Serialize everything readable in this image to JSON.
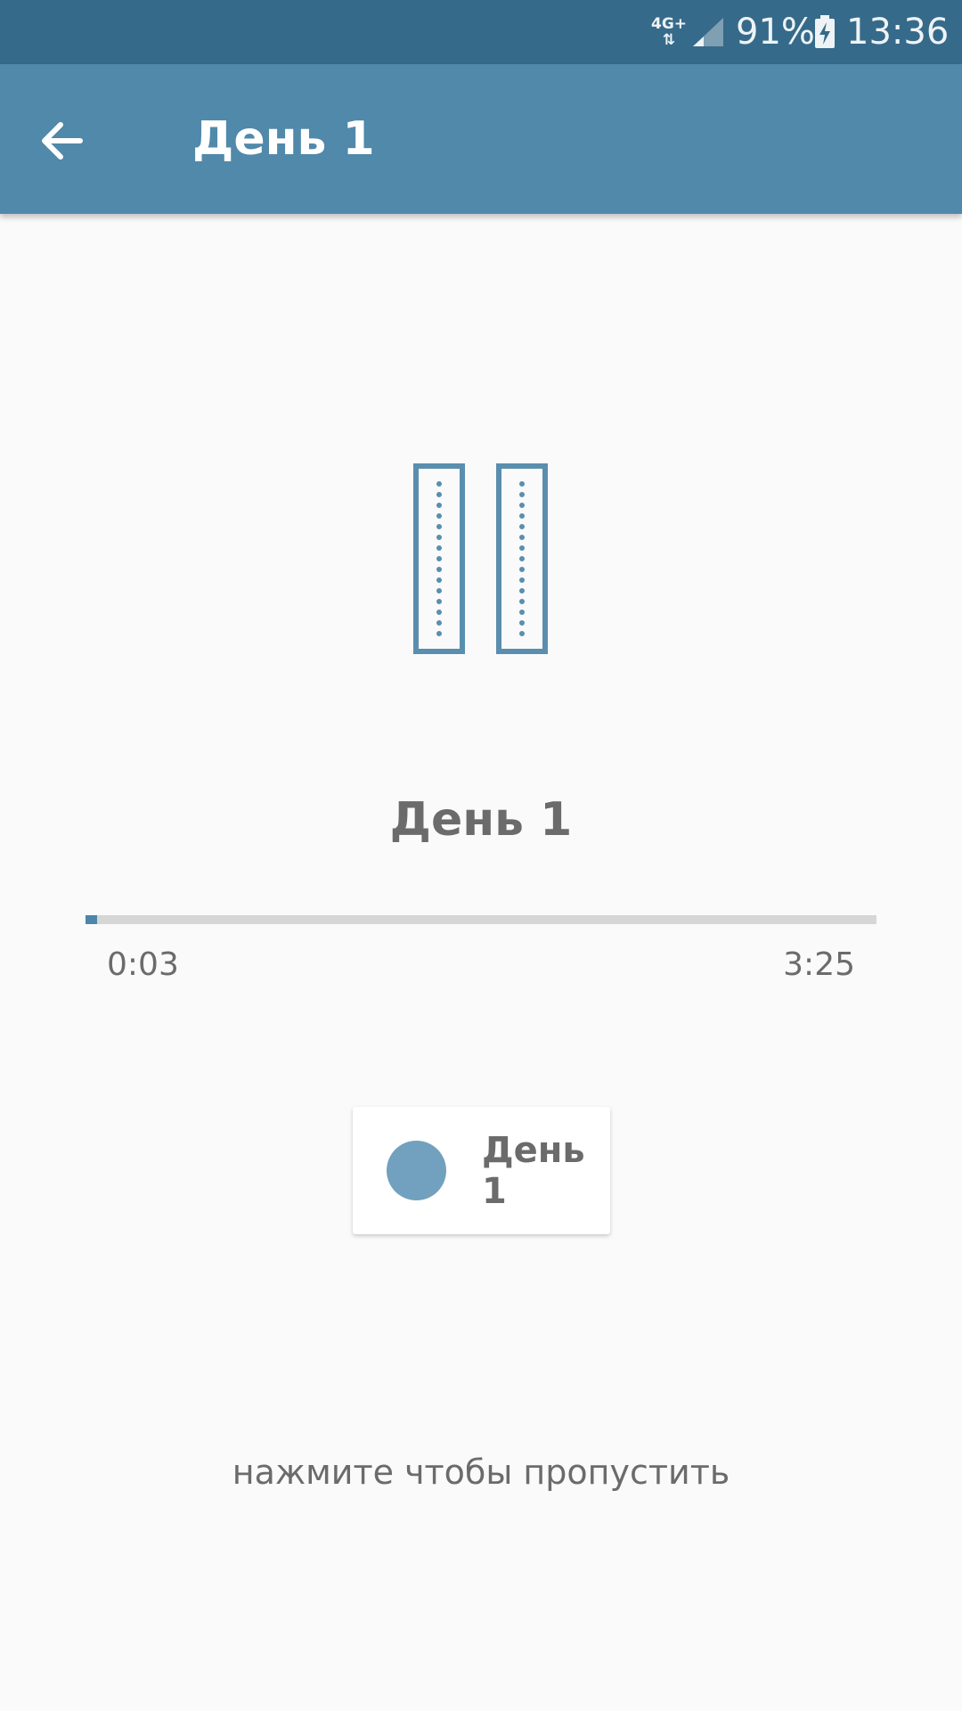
{
  "status_bar": {
    "network_top": "4G+",
    "network_bottom": "⇅",
    "battery_percent": "91%",
    "time": "13:36",
    "icons": [
      "signal-icon",
      "battery-charging-icon"
    ]
  },
  "app_bar": {
    "back_icon": "arrow-back-icon",
    "title": "День 1"
  },
  "player": {
    "pause_icon": "pause-icon",
    "track_title": "День 1",
    "progress_fraction": 0.015,
    "elapsed": "0:03",
    "total": "3:25"
  },
  "card": {
    "label": "День 1",
    "dot_color": "#71a1be"
  },
  "skip_hint": "нажмите чтобы пропустить",
  "colors": {
    "status_bar": "#366a8a",
    "app_bar": "#5089a9",
    "accent": "#4d86a8",
    "text_gray": "#6b6b6b",
    "background": "#fafafa"
  }
}
